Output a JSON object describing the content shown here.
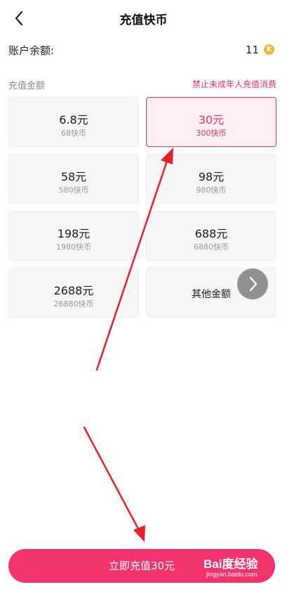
{
  "header": {
    "title": "充值快币",
    "back_icon": "chevron-left-icon"
  },
  "balance": {
    "label": "账户余额:",
    "value": "11",
    "coin_letter": "K"
  },
  "section": {
    "title": "充值金额",
    "notice": "禁止未成年人充值消费"
  },
  "options": [
    {
      "amount": "6.8元",
      "coins": "68快币"
    },
    {
      "amount": "30元",
      "coins": "300快币",
      "selected": true
    },
    {
      "amount": "58元",
      "coins": "580快币"
    },
    {
      "amount": "98元",
      "coins": "980快币"
    },
    {
      "amount": "198元",
      "coins": "1980快币"
    },
    {
      "amount": "688元",
      "coins": "6880快币"
    },
    {
      "amount": "2688元",
      "coins": "26880快币"
    },
    {
      "amount": "其他金额"
    }
  ],
  "cta": {
    "label": "立即充值30元"
  },
  "watermark": {
    "brand": "Bai度经验",
    "site": "jingyan.baidu.com"
  },
  "colors": {
    "accent": "#f2336c",
    "annotation_arrow": "#e8202a"
  }
}
